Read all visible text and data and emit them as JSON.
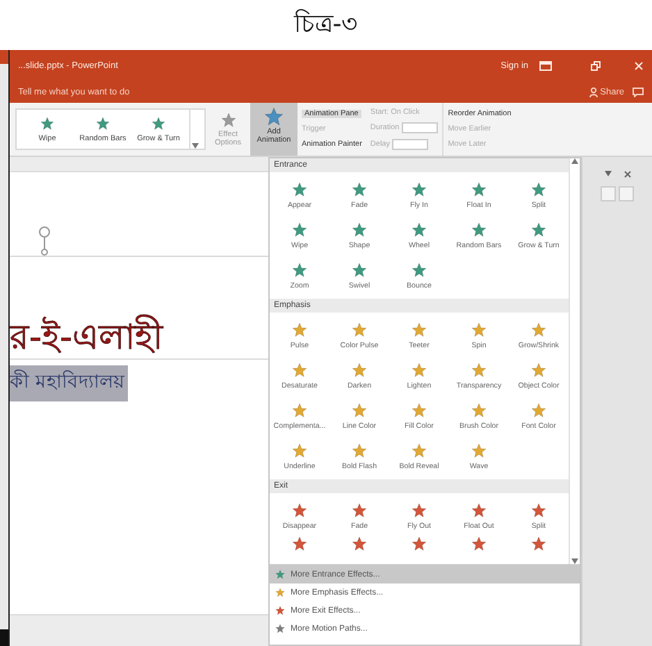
{
  "caption": "চিত্র-৩",
  "window": {
    "title": "...slide.pptx - PowerPoint",
    "sign_in": "Sign in",
    "share": "Share"
  },
  "tell_me": {
    "placeholder": "Tell me what you want to do"
  },
  "ribbon": {
    "gallery": [
      {
        "label": "Wipe"
      },
      {
        "label": "Random Bars"
      },
      {
        "label": "Grow & Turn"
      }
    ],
    "effect_options": "Effect Options",
    "add_animation": {
      "label": "Add Animation",
      "pressed": true
    },
    "advanced": [
      {
        "label": "Animation Pane",
        "disabled": false
      },
      {
        "label": "Trigger",
        "disabled": true
      },
      {
        "label": "Animation Painter",
        "disabled": false
      }
    ],
    "timing": [
      {
        "label": "Start: On Click",
        "disabled": true
      },
      {
        "label": "Duration",
        "disabled": true
      },
      {
        "label": "Delay",
        "disabled": true
      }
    ],
    "reorder": {
      "title": "Reorder Animation",
      "items": [
        {
          "label": "Move Earlier",
          "disabled": true
        },
        {
          "label": "Move Later",
          "disabled": true
        }
      ]
    }
  },
  "slide": {
    "title": "র-ই-এলাহী",
    "subtitle": "কী মহাবিদ্যালয়",
    "subtitle_selected": true
  },
  "gallery": {
    "sections": [
      {
        "title": "Entrance",
        "kind": "entrance",
        "cut_row": false,
        "effects": [
          {
            "label": "Appear"
          },
          {
            "label": "Fade"
          },
          {
            "label": "Fly In"
          },
          {
            "label": "Float In"
          },
          {
            "label": "Split"
          },
          {
            "label": "Wipe"
          },
          {
            "label": "Shape"
          },
          {
            "label": "Wheel"
          },
          {
            "label": "Random Bars"
          },
          {
            "label": "Grow & Turn"
          },
          {
            "label": "Zoom"
          },
          {
            "label": "Swivel"
          },
          {
            "label": "Bounce"
          }
        ]
      },
      {
        "title": "Emphasis",
        "kind": "emphasis",
        "cut_row": false,
        "effects": [
          {
            "label": "Pulse"
          },
          {
            "label": "Color Pulse"
          },
          {
            "label": "Teeter"
          },
          {
            "label": "Spin"
          },
          {
            "label": "Grow/Shrink"
          },
          {
            "label": "Desaturate"
          },
          {
            "label": "Darken"
          },
          {
            "label": "Lighten"
          },
          {
            "label": "Transparency"
          },
          {
            "label": "Object Color"
          },
          {
            "label": "Complementa..."
          },
          {
            "label": "Line Color"
          },
          {
            "label": "Fill Color"
          },
          {
            "label": "Brush Color"
          },
          {
            "label": "Font Color"
          },
          {
            "label": "Underline"
          },
          {
            "label": "Bold Flash"
          },
          {
            "label": "Bold Reveal"
          },
          {
            "label": "Wave"
          }
        ]
      },
      {
        "title": "Exit",
        "kind": "exit",
        "cut_row": true,
        "effects": [
          {
            "label": "Disappear"
          },
          {
            "label": "Fade"
          },
          {
            "label": "Fly Out"
          },
          {
            "label": "Float Out"
          },
          {
            "label": "Split"
          }
        ]
      }
    ],
    "menu": [
      {
        "label": "More Entrance Effects...",
        "kind": "entrance",
        "selected": true
      },
      {
        "label": "More Emphasis Effects...",
        "kind": "emphasis",
        "selected": false
      },
      {
        "label": "More Exit Effects...",
        "kind": "exit",
        "selected": false
      },
      {
        "label": "More Motion Paths...",
        "kind": "motion",
        "selected": false
      }
    ]
  }
}
